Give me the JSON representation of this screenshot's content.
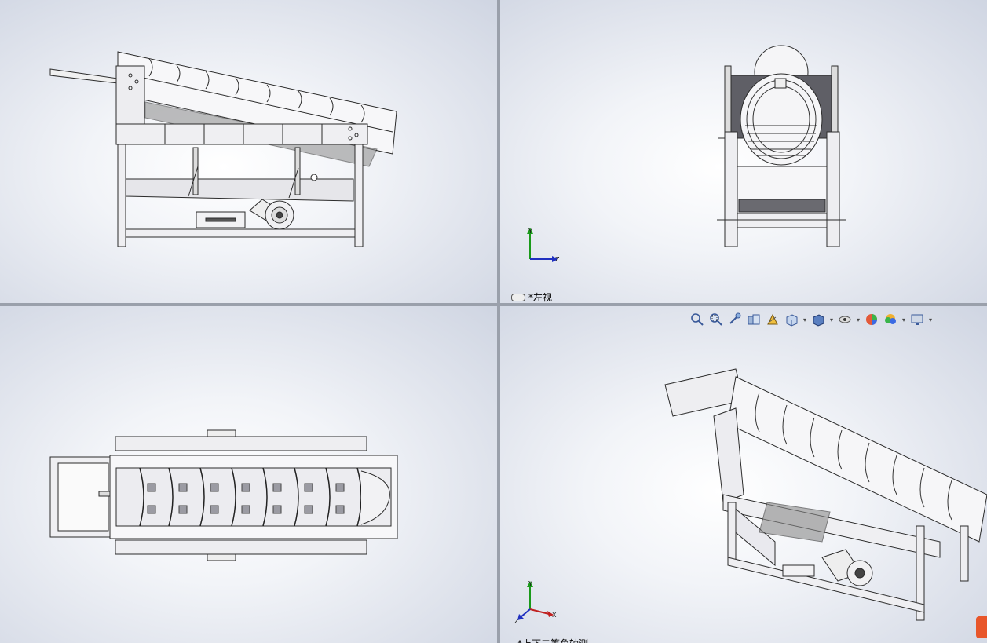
{
  "viewports": {
    "top_left": {
      "name": ""
    },
    "top_right": {
      "label": "*左视",
      "triad": {
        "y": "Y",
        "z": "Z"
      }
    },
    "bottom_left": {
      "name": ""
    },
    "bottom_right": {
      "label": "*上下二等角轴测",
      "triad": {
        "y": "Y",
        "x": "X",
        "z": "Z"
      },
      "toolbar": [
        {
          "name": "zoom-to-fit-icon"
        },
        {
          "name": "zoom-to-area-icon"
        },
        {
          "name": "previous-view-icon"
        },
        {
          "name": "section-view-icon"
        },
        {
          "name": "dynamic-annotation-icon"
        },
        {
          "name": "view-orientation-icon",
          "dropdown": true
        },
        {
          "name": "display-style-icon",
          "dropdown": true
        },
        {
          "name": "hide-show-items-icon",
          "dropdown": true
        },
        {
          "name": "edit-appearance-icon"
        },
        {
          "name": "apply-scene-icon",
          "dropdown": true
        },
        {
          "name": "view-settings-icon",
          "dropdown": true
        }
      ]
    }
  },
  "colors": {
    "background": "#dfe3ec",
    "line": "#2b2b2b",
    "frame_fill": "#ecebef",
    "splitter": "#9aa0ab"
  }
}
